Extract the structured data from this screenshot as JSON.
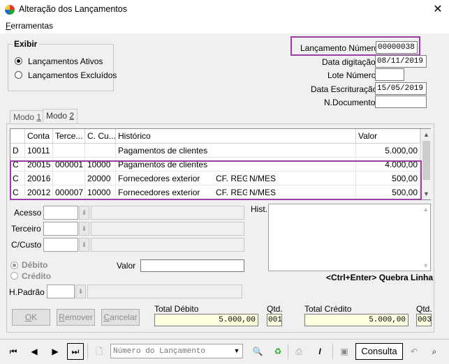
{
  "window": {
    "title": "Alteração dos Lançamentos",
    "close_label": "✕"
  },
  "menu": {
    "ferramentas_first": "F",
    "ferramentas_rest": "erramentas"
  },
  "exibir": {
    "title": "Exibir",
    "ativos": "Lançamentos Ativos",
    "excluidos": "Lançamentos Excluídos",
    "selected": "ativos"
  },
  "header_fields": {
    "lancamento_numero_label": "Lançamento Número",
    "lancamento_numero_value": "00000038",
    "data_digitacao_label": "Data digitação",
    "data_digitacao_value": "08/11/2019",
    "lote_numero_label": "Lote Número",
    "lote_numero_value": "",
    "data_escrituracao_label": "Data Escrituração",
    "data_escrituracao_value": "15/05/2019",
    "n_documento_label": "N.Documento",
    "n_documento_value": ""
  },
  "tabs": [
    {
      "label_pre": "Modo ",
      "label_u": "1"
    },
    {
      "label_pre": "Modo ",
      "label_u": "2"
    }
  ],
  "grid": {
    "columns": [
      "",
      "Conta",
      "Terce...",
      "C. Cu...",
      "Histórico",
      "Valor"
    ],
    "rows": [
      {
        "dc": "D",
        "conta": "10011",
        "terceiro": "",
        "ccusto": "",
        "historico": "Pagamentos de clientes",
        "extra1": "",
        "extra2": "",
        "valor": "5.000,00"
      },
      {
        "dc": "C",
        "conta": "20015",
        "terceiro": "000001",
        "ccusto": "10000",
        "historico": "Pagamentos de clientes",
        "extra1": "",
        "extra2": "",
        "valor": "4.000,00"
      },
      {
        "dc": "C",
        "conta": "20016",
        "terceiro": "",
        "ccusto": "20000",
        "historico": "Fornecedores exterior",
        "extra1": "CF. REG",
        "extra2": "N/MES",
        "valor": "500,00"
      },
      {
        "dc": "C",
        "conta": "20012",
        "terceiro": "000007",
        "ccusto": "10000",
        "historico": "Fornecedores exterior",
        "extra1": "CF. REG",
        "extra2": "N/MES",
        "valor": "500,00"
      }
    ]
  },
  "detail": {
    "acesso_label": "Acesso",
    "terceiro_label": "Terceiro",
    "ccusto_label": "C/Custo",
    "hist_label": "Hist.",
    "debito_label": "Débito",
    "credito_label": "Crédito",
    "valor_label": "Valor",
    "valor_value": "",
    "hpadrao_label": "H.Padrão",
    "quebra_linha_hint": "<Ctrl+Enter> Quebra Linha"
  },
  "buttons": {
    "ok_u": "O",
    "ok_rest": "K",
    "remover_u": "R",
    "remover_rest": "emover",
    "cancelar_u": "C",
    "cancelar_rest": "ancelar"
  },
  "totals": {
    "total_debito_label": "Total Débito",
    "total_debito_value": "5.000,00",
    "qtd_debito_label": "Qtd.",
    "qtd_debito_value": "001",
    "total_credito_label": "Total Crédito",
    "total_credito_value": "5.000,00",
    "qtd_credito_label": "Qtd.",
    "qtd_credito_value": "003"
  },
  "toolbar": {
    "search_placeholder": "Número do Lançamento",
    "consulta_label": "Consulta"
  },
  "colors": {
    "highlight": "#9b3ea4",
    "total_bg": "#ffffe1"
  }
}
